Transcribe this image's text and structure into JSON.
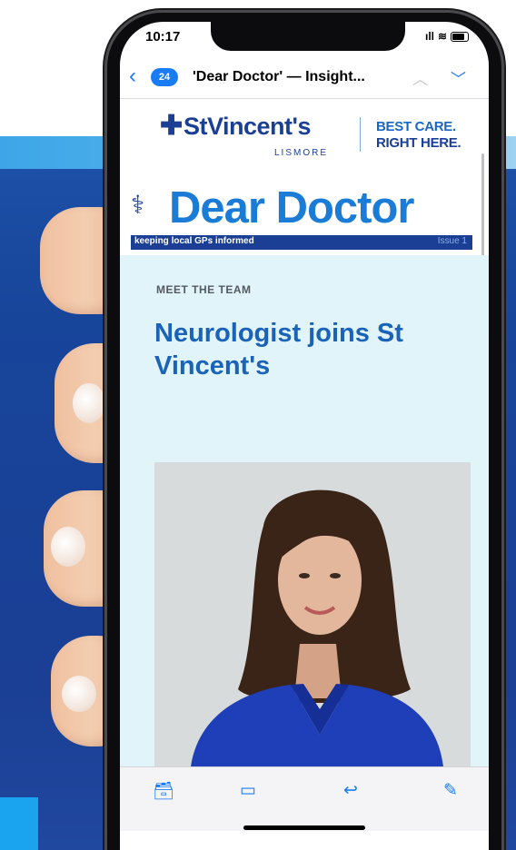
{
  "status": {
    "time": "10:17",
    "signal": "ıll"
  },
  "nav": {
    "back_count": "24",
    "title": "'Dear Doctor' — Insight..."
  },
  "email": {
    "logo_name": "StVincent's",
    "logo_sub": "LISMORE",
    "tagline_1": "BEST CARE.",
    "tagline_2": "RIGHT HERE.",
    "masthead_title": "Dear Doctor",
    "masthead_subtitle": "keeping local GPs informed",
    "issue": "Issue 1",
    "section_kicker": "MEET THE TEAM",
    "headline": "Neurologist joins St Vincent's"
  },
  "toolbar": {
    "icons": [
      "archive-icon",
      "folder-icon",
      "reply-icon",
      "compose-icon"
    ]
  },
  "colors": {
    "accent": "#1a7cf5",
    "brand_navy": "#1a3f95",
    "brand_blue": "#1a7cd6",
    "section_bg": "#e0f4f9"
  }
}
